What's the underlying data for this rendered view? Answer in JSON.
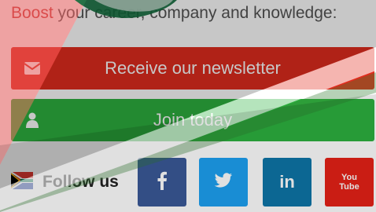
{
  "tagline": {
    "accent": "Boost",
    "rest": " your career, company and knowledge:"
  },
  "buttons": {
    "newsletter_label": "Receive our newsletter",
    "join_label": "Join today"
  },
  "follow": {
    "label": "Follow us"
  },
  "social": {
    "linkedin_text": "in",
    "youtube_text": "You Tube"
  },
  "colors": {
    "newsletter": "#e22c1e",
    "join": "#2db13f",
    "facebook": "#3b5998",
    "twitter": "#1da1f2",
    "linkedin": "#0e76a8",
    "youtube": "#e62117"
  },
  "icons": {
    "newsletter": "envelope-icon",
    "join": "user-icon",
    "flag": "south-africa-flag-icon",
    "facebook": "facebook-icon",
    "twitter": "twitter-icon",
    "linkedin": "linkedin-icon",
    "youtube": "youtube-icon"
  }
}
